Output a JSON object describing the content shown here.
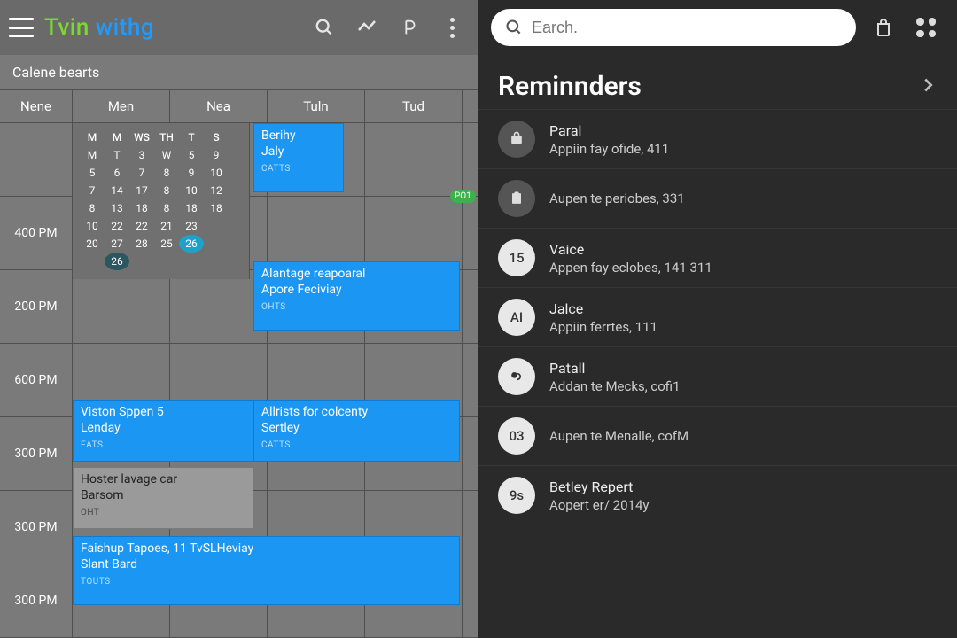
{
  "left": {
    "app_title_part1": "Tvin",
    "app_title_part2": " withg",
    "section_label": "Calene bearts",
    "day_cols": [
      "Nene",
      "Men",
      "Nea",
      "Tuln",
      "Tud",
      ""
    ],
    "time_labels": [
      "",
      "400 PM",
      "200 PM",
      "600 PM",
      "300 PM",
      "300 PM",
      "300 PM"
    ],
    "month_hdr": [
      "M",
      "M",
      "WS",
      "TH",
      "T",
      "S"
    ],
    "month_rows": [
      [
        "M",
        "T",
        "3",
        "W",
        "5",
        "9"
      ],
      [
        "5",
        "6",
        "7",
        "8",
        "9",
        "10"
      ],
      [
        "7",
        "14",
        "17",
        "8",
        "10",
        "12"
      ],
      [
        "8",
        "13",
        "18",
        "8",
        "18",
        "18"
      ],
      [
        "10",
        "22",
        "22",
        "21",
        "23",
        ""
      ],
      [
        "20",
        "27",
        "28",
        "25",
        "26",
        ""
      ],
      [
        "",
        "26",
        "",
        "",
        "",
        ""
      ]
    ],
    "events": {
      "e1": {
        "l1": "Berihy",
        "l2": "Jaly",
        "tag": "CATTS"
      },
      "e2": {
        "l1": "Alantage reapoaral",
        "l2": "Apore Feciviay",
        "tag": "OHTS"
      },
      "e3": {
        "l1": "Viston Sppen 5",
        "l2": "Lenday",
        "tag": "EATS"
      },
      "e4": {
        "l1": "Allrists for colcenty",
        "l2": "Sertley",
        "tag": "CATTS"
      },
      "e5": {
        "l1": "Hoster lavage car",
        "l2": "Barsom",
        "tag": "OHT"
      },
      "e6": {
        "l1": "Faishup Tapoes, 11 TvSLHeviay",
        "l2": "Slant Bard",
        "tag": "TOUTS"
      },
      "chip": "PO1"
    }
  },
  "right": {
    "search_placeholder": "Earch.",
    "panel_title": "Reminnders",
    "reminders": [
      {
        "avatar": "icon-brief",
        "title": "Paral",
        "sub": "Appiin fay ofide, 411"
      },
      {
        "avatar": "icon-clip",
        "title": "",
        "sub": "Aupen te periobes, 331"
      },
      {
        "avatar": "15",
        "title": "Vaice",
        "sub": "Appen fay eclobes, 141 311"
      },
      {
        "avatar": "AI",
        "title": "Jalce",
        "sub": "Appiin ferrtes, 111"
      },
      {
        "avatar": "icon-note",
        "title": "Patall",
        "sub": "Addan te Mecks, cofi1"
      },
      {
        "avatar": "03",
        "title": "",
        "sub": "Aupen te Menalle, cofM"
      },
      {
        "avatar": "9s",
        "title": "Betley Repert",
        "sub": "Aopert er/ 2014y"
      }
    ]
  }
}
